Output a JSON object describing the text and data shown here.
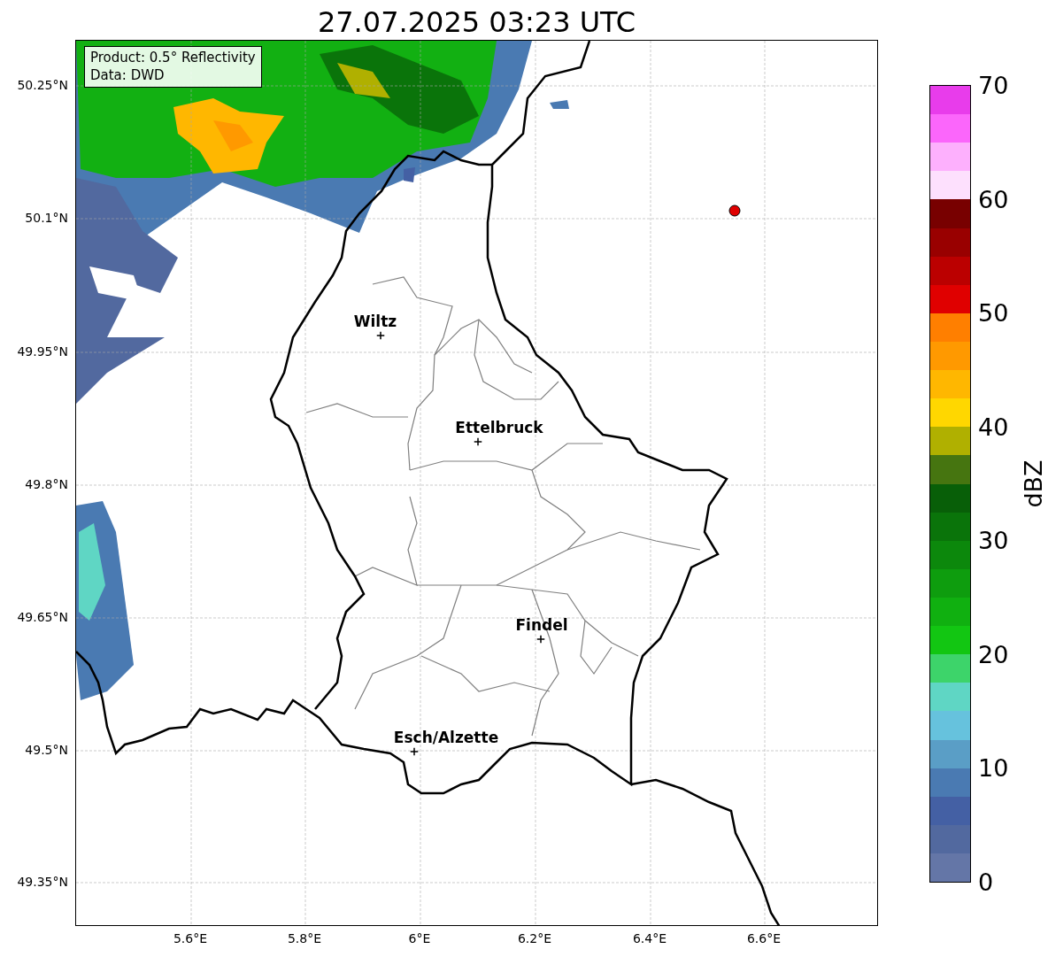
{
  "title": "27.07.2025 03:23 UTC",
  "info_box": [
    "Product: 0.5° Reflectivity",
    "Data: DWD"
  ],
  "y_ticks": [
    "50.25°N",
    "50.1°N",
    "49.95°N",
    "49.8°N",
    "49.65°N",
    "49.5°N",
    "49.35°N"
  ],
  "x_ticks": [
    "5.6°E",
    "5.8°E",
    "6°E",
    "6.2°E",
    "6.4°E",
    "6.6°E"
  ],
  "cities": [
    {
      "name": "Wiltz"
    },
    {
      "name": "Ettelbruck"
    },
    {
      "name": "Findel"
    },
    {
      "name": "Esch/Alzette"
    }
  ],
  "colorbar": {
    "label": "dBZ",
    "ticks": [
      "70",
      "60",
      "50",
      "40",
      "30",
      "20",
      "10",
      "0"
    ],
    "segments": [
      {
        "color": "#e83ceb"
      },
      {
        "color": "#fb66fb"
      },
      {
        "color": "#fdb0fd"
      },
      {
        "color": "#fde0fd"
      },
      {
        "color": "#780000"
      },
      {
        "color": "#990000"
      },
      {
        "color": "#bb0000"
      },
      {
        "color": "#e00000"
      },
      {
        "color": "#ff7f00"
      },
      {
        "color": "#ff9900"
      },
      {
        "color": "#ffb700"
      },
      {
        "color": "#ffd700"
      },
      {
        "color": "#b0b000"
      },
      {
        "color": "#467510"
      },
      {
        "color": "#085f08"
      },
      {
        "color": "#0a740a"
      },
      {
        "color": "#0c880c"
      },
      {
        "color": "#0e9d0e"
      },
      {
        "color": "#10b010"
      },
      {
        "color": "#12c612"
      },
      {
        "color": "#3dd46a"
      },
      {
        "color": "#5fd6c4"
      },
      {
        "color": "#66c2dd"
      },
      {
        "color": "#5a9ec6"
      },
      {
        "color": "#4a7ab2"
      },
      {
        "color": "#4460a4"
      },
      {
        "color": "#52699f"
      },
      {
        "color": "#6476a7"
      }
    ]
  }
}
